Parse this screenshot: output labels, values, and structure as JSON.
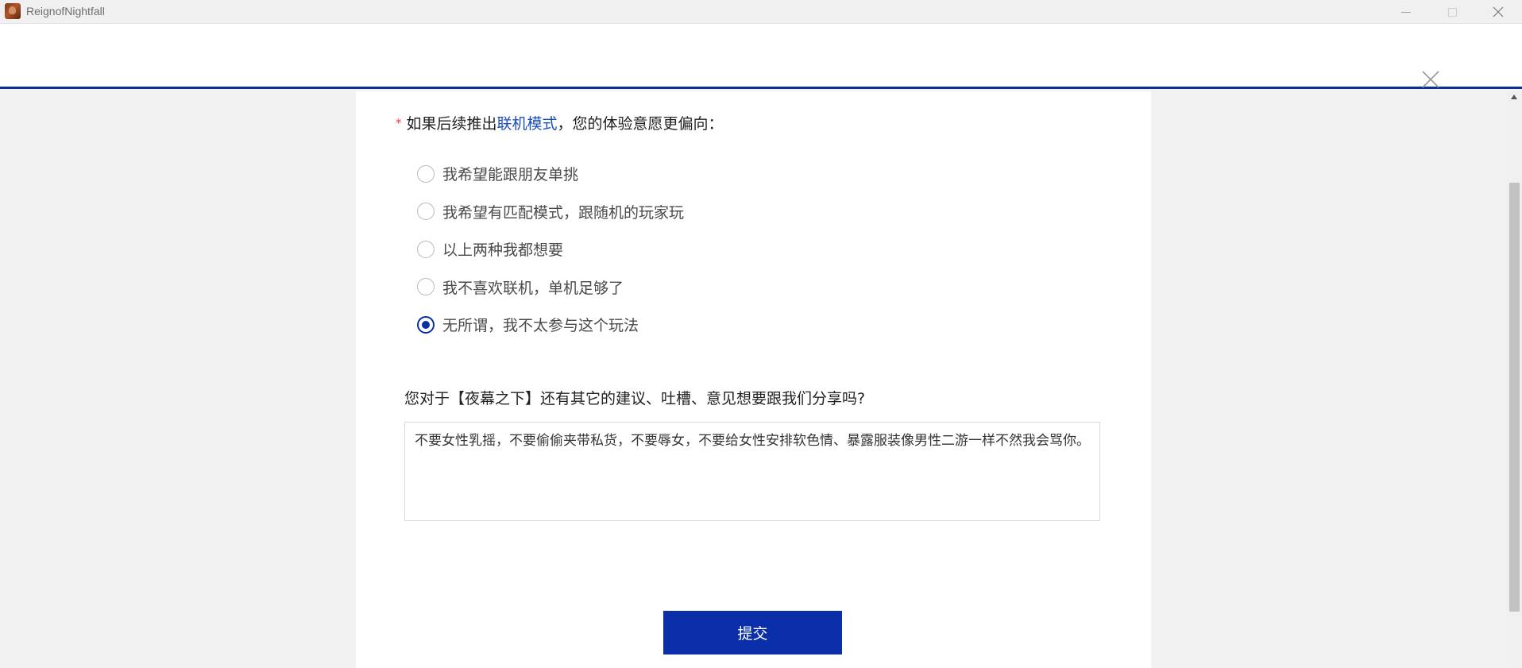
{
  "window": {
    "app_title": "ReignofNightfall",
    "icon": "app-game-icon"
  },
  "dialog": {
    "close_icon": "close-icon"
  },
  "survey": {
    "question1": {
      "required_mark": "*",
      "prefix": "如果后续推出",
      "highlight": "联机模式",
      "suffix": "，您的体验意愿更偏向：",
      "options": [
        "我希望能跟朋友单挑",
        "我希望有匹配模式，跟随机的玩家玩",
        "以上两种我都想要",
        "我不喜欢联机，单机足够了",
        "无所谓，我不太参与这个玩法"
      ],
      "selected_index": 4
    },
    "question2": {
      "title": "您对于【夜幕之下】还有其它的建议、吐槽、意见想要跟我们分享吗?",
      "answer": "不要女性乳摇，不要偷偷夹带私货，不要辱女，不要给女性安排软色情、暴露服装像男性二游一样不然我会骂你。"
    },
    "submit_label": "提交"
  },
  "colors": {
    "accent": "#0a2fa8",
    "link": "#1a4dbf",
    "required": "#e23b3b"
  }
}
